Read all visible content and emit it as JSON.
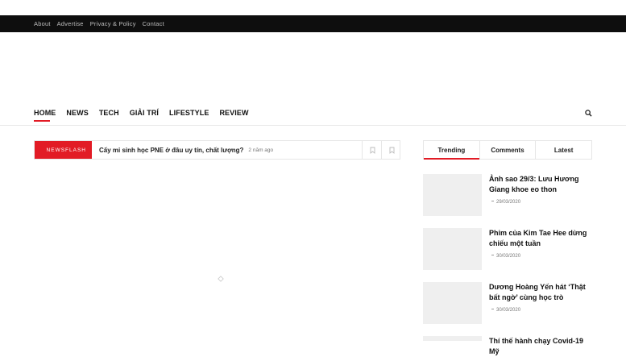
{
  "topbar": {
    "links": [
      "About",
      "Advertise",
      "Privacy & Policy",
      "Contact"
    ]
  },
  "nav": {
    "items": [
      "HOME",
      "NEWS",
      "TECH",
      "GIẢI TRÍ",
      "LIFESTYLE",
      "REVIEW"
    ],
    "active": "HOME"
  },
  "newsflash": {
    "label": "NEWSFLASH",
    "title": "Cấy mi sinh học PNE ở đâu uy tín, chất lượng?",
    "time": "2 năm ago"
  },
  "sidebar": {
    "tabs": [
      "Trending",
      "Comments",
      "Latest"
    ],
    "active_tab": "Trending",
    "posts": [
      {
        "title": "Ảnh sao 29/3: Lưu Hương Giang khoe eo thon",
        "date": "29/03/2020"
      },
      {
        "title": "Phim của Kim Tae Hee dừng chiếu một tuần",
        "date": "30/03/2020"
      },
      {
        "title": "Dương Hoàng Yến hát ‘Thật bất ngờ’ cùng học trò",
        "date": "30/03/2020"
      },
      {
        "title": "Thí thế hành chạy Covid-19 Mỹ",
        "date": ""
      }
    ]
  },
  "colors": {
    "accent": "#e21b25",
    "topbar_bg": "#0e0e0e",
    "thumb_bg": "#efefef"
  }
}
